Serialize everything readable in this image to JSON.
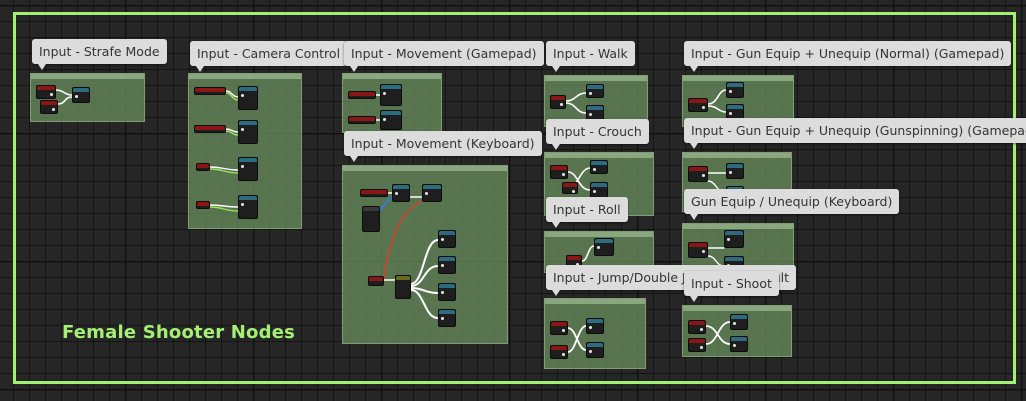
{
  "graph": {
    "frame_title": "Female Shooter Nodes",
    "frame_color": "#a4f074",
    "comment_color": "#688c5c"
  },
  "comments": [
    {
      "label": "Input - Strafe Mode"
    },
    {
      "label": "Input - Camera Control"
    },
    {
      "label": "Input - Movement (Gamepad)"
    },
    {
      "label": "Input - Movement (Keyboard)"
    },
    {
      "label": "Input - Walk"
    },
    {
      "label": "Input - Crouch"
    },
    {
      "label": "Input - Roll"
    },
    {
      "label": "Input - Jump/Double Jump/Somersault"
    },
    {
      "label": "Input - Gun Equip + Unequip (Normal) (Gamepad)"
    },
    {
      "label": "Input - Gun Equip + Unequip (Gunspinning) (Gamepad)"
    },
    {
      "label": "Gun Equip / Unequip (Keyboard)"
    },
    {
      "label": "Input - Shoot"
    }
  ],
  "node_colors": {
    "event": "#8a1616",
    "function": "#2d6c80",
    "wire_exec": "#ffffff",
    "wire_float": "#9be35a",
    "wire_red": "#d8402c",
    "wire_blue": "#2f7de0"
  }
}
